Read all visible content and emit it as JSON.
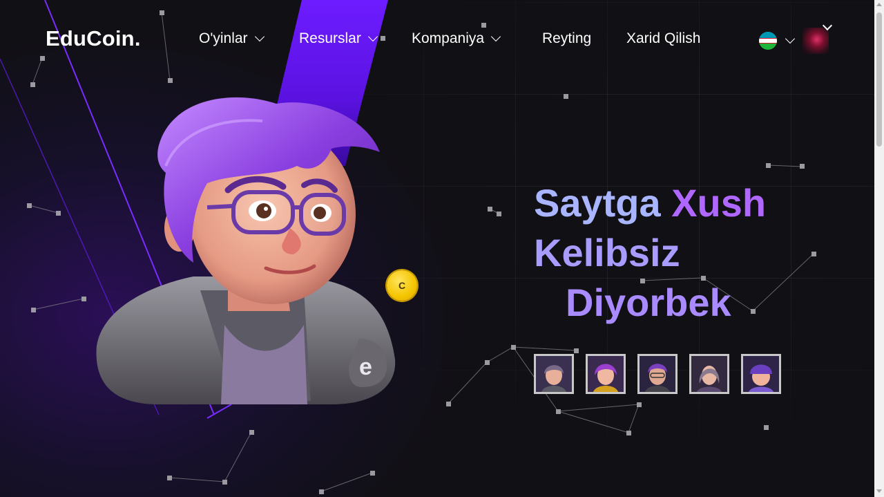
{
  "header": {
    "logo": "EduCoin.",
    "nav": [
      {
        "label": "O'yinlar",
        "dropdown": true
      },
      {
        "label": "Resurslar",
        "dropdown": true
      },
      {
        "label": "Kompaniya",
        "dropdown": true
      },
      {
        "label": "Reyting",
        "dropdown": false
      },
      {
        "label": "Xarid Qilish",
        "dropdown": false
      }
    ],
    "language_flag": "uzbekistan-flag-icon"
  },
  "hero": {
    "line1_a": "Saytga",
    "line1_b": "Xush",
    "line2": "Kelibsiz",
    "line3": "Diyorbek",
    "coin_label": "C"
  },
  "characters": [
    {
      "name": "character-1",
      "hair": "#7a6a8a"
    },
    {
      "name": "character-2",
      "hair": "#9a3fd0"
    },
    {
      "name": "character-3",
      "hair": "#7a40c0"
    },
    {
      "name": "character-4",
      "hair": "#8a7a90"
    },
    {
      "name": "character-5",
      "hair": "#6a3fc0"
    }
  ],
  "colors": {
    "background": "#111014",
    "accent_purple": "#7b2cff",
    "title_blue": "#aab5ff",
    "title_purple": "#b067ff",
    "coin": "#f5c400"
  }
}
